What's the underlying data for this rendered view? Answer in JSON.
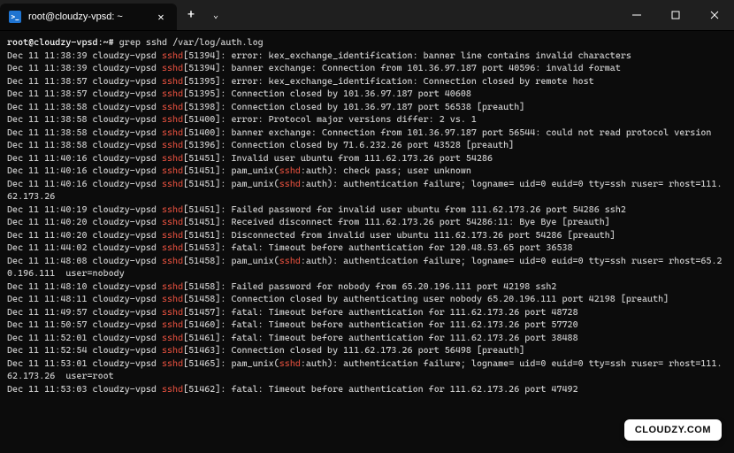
{
  "titlebar": {
    "tab_title": "root@cloudzy-vpsd: ~",
    "ps_icon_label": ">_"
  },
  "prompt": {
    "user_host": "root@cloudzy-vpsd",
    "path": "~",
    "symbol": "#",
    "command": "grep sshd /var/log/auth.log"
  },
  "log_defaults": {
    "host": "cloudzy-vpsd",
    "proc": "sshd"
  },
  "logs": [
    {
      "ts": "Dec 11 11:38:39",
      "pid": "51394",
      "msg": "error: kex_exchange_identification: banner line contains invalid characters"
    },
    {
      "ts": "Dec 11 11:38:39",
      "pid": "51394",
      "msg": "banner exchange: Connection from 101.36.97.187 port 40596: invalid format"
    },
    {
      "ts": "Dec 11 11:38:57",
      "pid": "51395",
      "msg": "error: kex_exchange_identification: Connection closed by remote host"
    },
    {
      "ts": "Dec 11 11:38:57",
      "pid": "51395",
      "msg": "Connection closed by 101.36.97.187 port 40608"
    },
    {
      "ts": "Dec 11 11:38:58",
      "pid": "51398",
      "msg": "Connection closed by 101.36.97.187 port 56538 [preauth]"
    },
    {
      "ts": "Dec 11 11:38:58",
      "pid": "51400",
      "msg": "error: Protocol major versions differ: 2 vs. 1"
    },
    {
      "ts": "Dec 11 11:38:58",
      "pid": "51400",
      "msg": "banner exchange: Connection from 101.36.97.187 port 56544: could not read protocol version"
    },
    {
      "ts": "Dec 11 11:38:58",
      "pid": "51396",
      "msg": "Connection closed by 71.6.232.26 port 43528 [preauth]"
    },
    {
      "ts": "Dec 11 11:40:16",
      "pid": "51451",
      "msg": "Invalid user ubuntu from 111.62.173.26 port 54286"
    },
    {
      "ts": "Dec 11 11:40:16",
      "pid": "51451",
      "msg_pre": "pam_unix(",
      "msg_mid": "sshd",
      "msg_post": ":auth): check pass; user unknown"
    },
    {
      "ts": "Dec 11 11:40:16",
      "pid": "51451",
      "msg_pre": "pam_unix(",
      "msg_mid": "sshd",
      "msg_post": ":auth): authentication failure; logname= uid=0 euid=0 tty=ssh ruser= rhost=111.62.173.26"
    },
    {
      "ts": "Dec 11 11:40:19",
      "pid": "51451",
      "msg": "Failed password for invalid user ubuntu from 111.62.173.26 port 54286 ssh2"
    },
    {
      "ts": "Dec 11 11:40:20",
      "pid": "51451",
      "msg": "Received disconnect from 111.62.173.26 port 54286:11: Bye Bye [preauth]"
    },
    {
      "ts": "Dec 11 11:40:20",
      "pid": "51451",
      "msg": "Disconnected from invalid user ubuntu 111.62.173.26 port 54286 [preauth]"
    },
    {
      "ts": "Dec 11 11:44:02",
      "pid": "51453",
      "msg": "fatal: Timeout before authentication for 120.48.53.65 port 36538"
    },
    {
      "ts": "Dec 11 11:48:08",
      "pid": "51458",
      "msg_pre": "pam_unix(",
      "msg_mid": "sshd",
      "msg_post": ":auth): authentication failure; logname= uid=0 euid=0 tty=ssh ruser= rhost=65.20.196.111  user=nobody"
    },
    {
      "ts": "Dec 11 11:48:10",
      "pid": "51458",
      "msg": "Failed password for nobody from 65.20.196.111 port 42198 ssh2"
    },
    {
      "ts": "Dec 11 11:48:11",
      "pid": "51458",
      "msg": "Connection closed by authenticating user nobody 65.20.196.111 port 42198 [preauth]"
    },
    {
      "ts": "Dec 11 11:49:57",
      "pid": "51457",
      "msg": "fatal: Timeout before authentication for 111.62.173.26 port 48728"
    },
    {
      "ts": "Dec 11 11:50:57",
      "pid": "51460",
      "msg": "fatal: Timeout before authentication for 111.62.173.26 port 57720"
    },
    {
      "ts": "Dec 11 11:52:01",
      "pid": "51461",
      "msg": "fatal: Timeout before authentication for 111.62.173.26 port 38488"
    },
    {
      "ts": "Dec 11 11:52:54",
      "pid": "51463",
      "msg": "Connection closed by 111.62.173.26 port 56498 [preauth]"
    },
    {
      "ts": "Dec 11 11:53:01",
      "pid": "51465",
      "msg_pre": "pam_unix(",
      "msg_mid": "sshd",
      "msg_post": ":auth): authentication failure; logname= uid=0 euid=0 tty=ssh ruser= rhost=111.62.173.26  user=root"
    },
    {
      "ts": "Dec 11 11:53:03",
      "pid": "51462",
      "msg": "fatal: Timeout before authentication for 111.62.173.26 port 47492"
    }
  ],
  "watermark": "CLOUDZY.COM"
}
